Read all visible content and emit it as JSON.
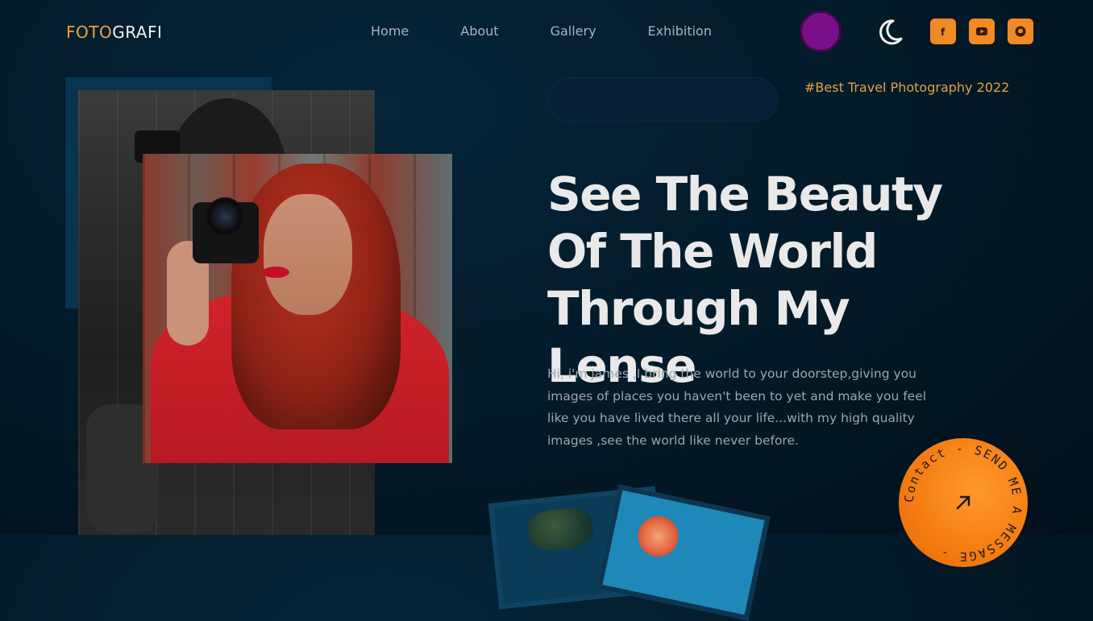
{
  "logo": {
    "part1": "FOTO",
    "part2": "GRAFI"
  },
  "nav": [
    {
      "label": "Home"
    },
    {
      "label": "About"
    },
    {
      "label": "Gallery"
    },
    {
      "label": "Exhibition"
    }
  ],
  "theme_toggle_icon": "moon-icon",
  "social": [
    {
      "name": "facebook-icon",
      "glyph": "f"
    },
    {
      "name": "youtube-icon",
      "glyph": "▶"
    },
    {
      "name": "github-icon",
      "glyph": ""
    }
  ],
  "tag": "#Best Travel Photography 2022",
  "headline": "See The Beauty Of The World Through My Lense",
  "bio": "Hi, i'm james ,I bring the world to your doorstep,giving you images of places you haven't been to yet and make you feel like you have lived there all your life...with my high quality images ,see the world like never before.",
  "contact_badge": {
    "text": "Contact - SEND ME A MESSAGE - "
  },
  "colors": {
    "accent": "#f08a24",
    "purple": "#7a0f8a",
    "bg": "#031b2a"
  }
}
